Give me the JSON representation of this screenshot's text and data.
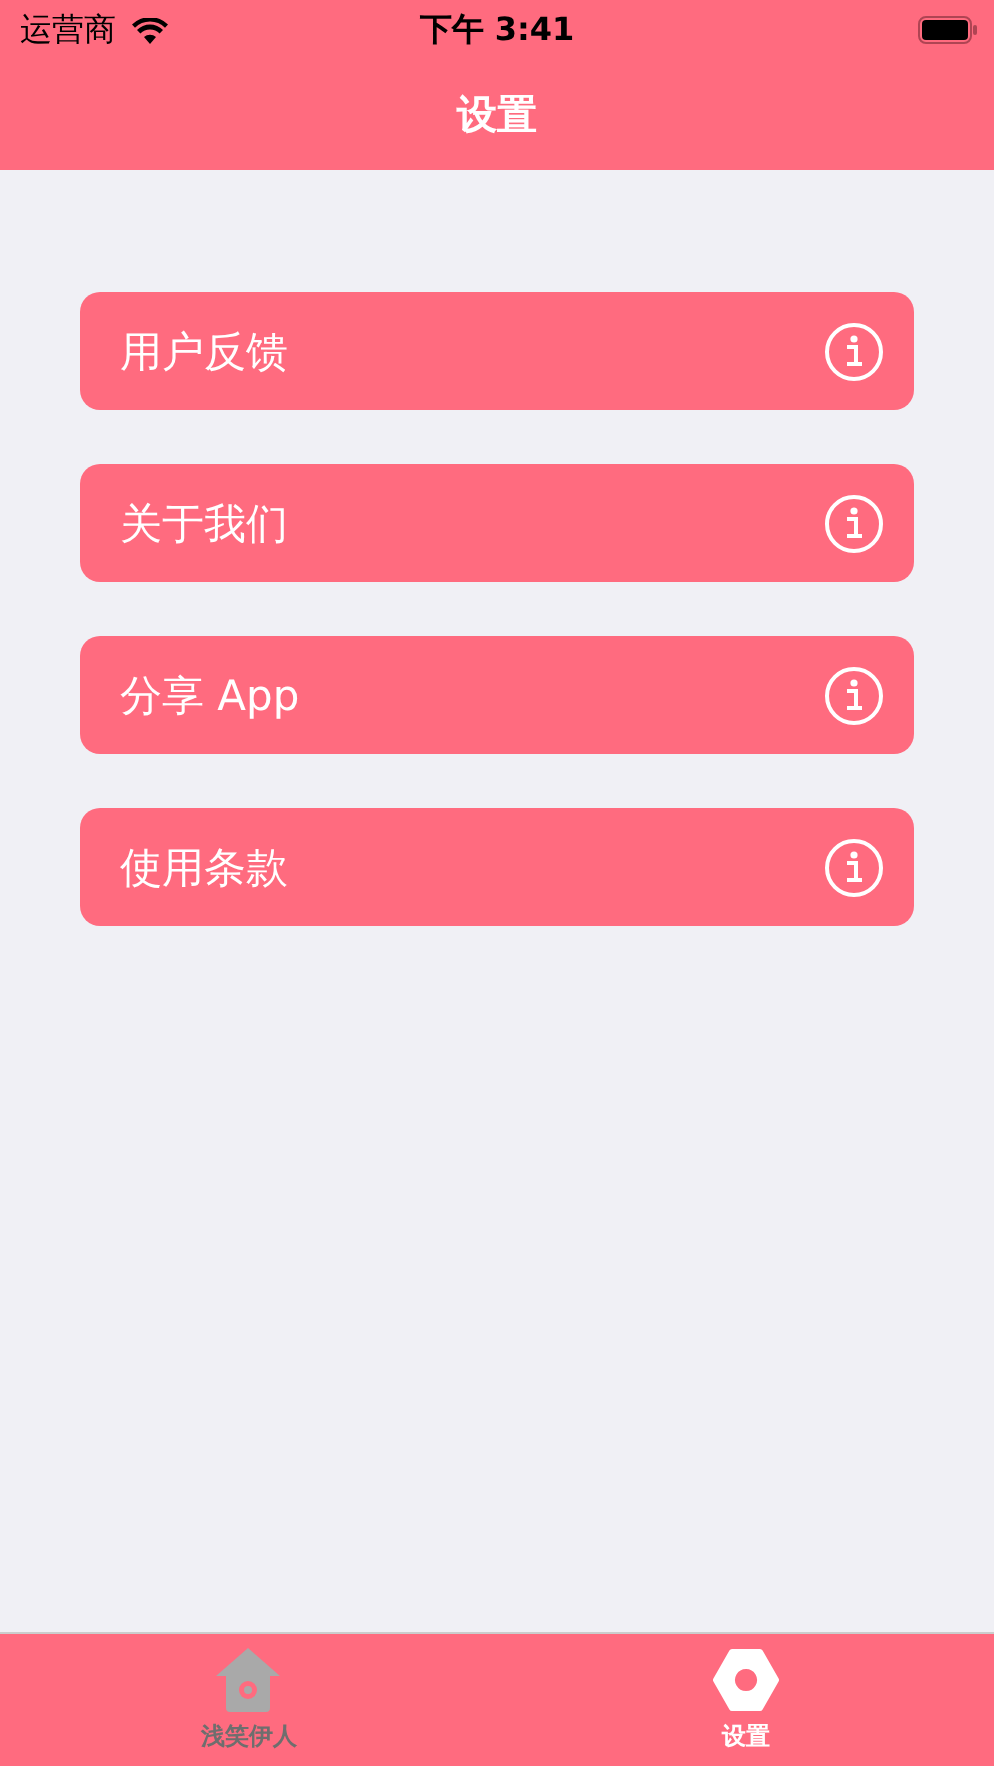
{
  "status_bar": {
    "carrier": "运营商",
    "time": "下午 3:41"
  },
  "nav": {
    "title": "设置"
  },
  "menu": [
    {
      "label": "用户反馈"
    },
    {
      "label": "关于我们"
    },
    {
      "label": "分享 App"
    },
    {
      "label": "使用条款"
    }
  ],
  "tab_bar": [
    {
      "label": "浅笑伊人",
      "kind": "home",
      "selected": false
    },
    {
      "label": "设置",
      "kind": "settings",
      "selected": true
    }
  ]
}
